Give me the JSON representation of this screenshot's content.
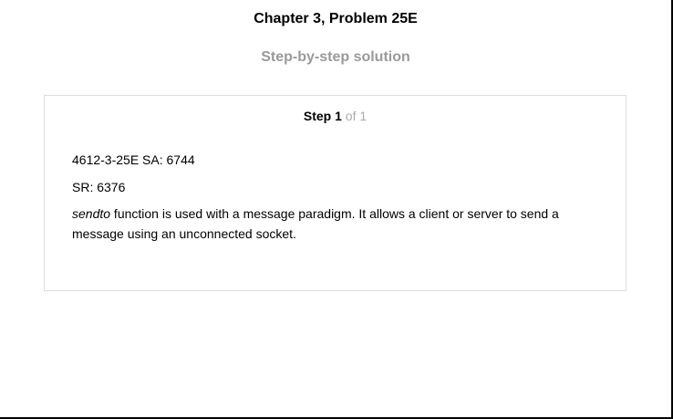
{
  "header": {
    "title": "Chapter 3, Problem 25E",
    "subtitle": "Step-by-step solution"
  },
  "step": {
    "word": "Step",
    "number": "1",
    "of_text": "of 1"
  },
  "content": {
    "line1": "4612-3-25E SA: 6744",
    "line2": "SR: 6376",
    "para_italic": "sendto",
    "para_rest": " function is used with a message paradigm. It allows a client or server to send a message using an unconnected socket."
  },
  "colors": {
    "subtitle": "#9a9a9a",
    "step_of": "#aaaaaa",
    "box_border": "#dcdcdc"
  }
}
